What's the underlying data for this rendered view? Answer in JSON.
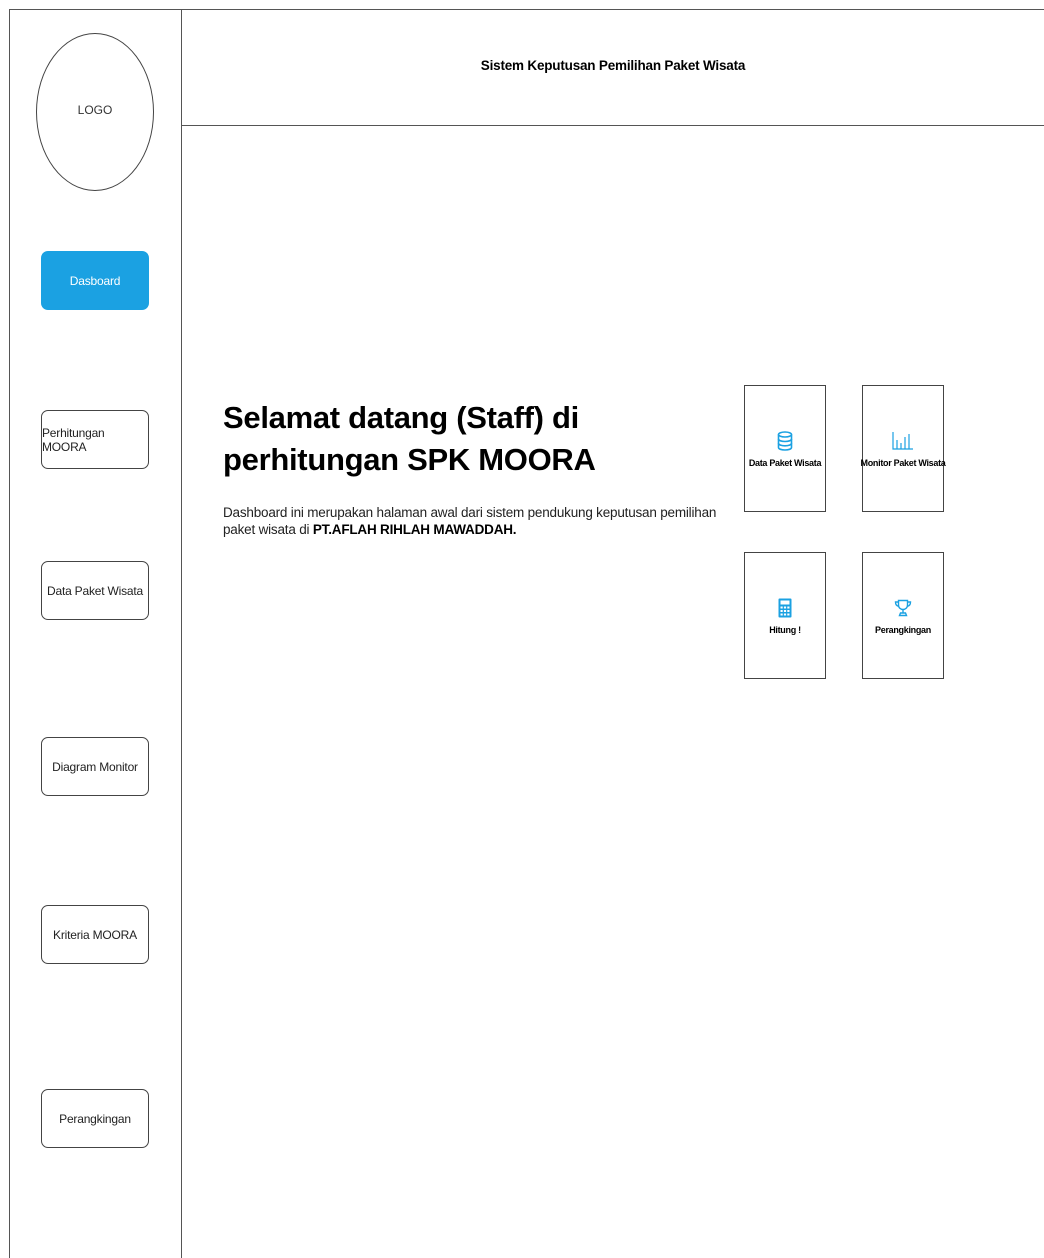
{
  "logo": {
    "text": "LOGO"
  },
  "header": {
    "title": "Sistem Keputusan Pemilihan Paket Wisata"
  },
  "sidebar": {
    "items": [
      {
        "label": "Dasboard",
        "active": true,
        "icon": ""
      },
      {
        "label": "Perhitungan MOORA",
        "active": false
      },
      {
        "label": "Data Paket Wisata",
        "active": false
      },
      {
        "label": "Diagram Monitor",
        "active": false
      },
      {
        "label": "Kriteria MOORA",
        "active": false
      },
      {
        "label": "Perangkingan",
        "active": false
      }
    ]
  },
  "main": {
    "welcome_title": "Selamat datang (Staff) di perhitungan SPK MOORA",
    "welcome_desc_prefix": "Dashboard ini merupakan halaman awal dari sistem pendukung keputusan pemilihan paket wisata di ",
    "welcome_desc_company": "PT.AFLAH RIHLAH MAWADDAH."
  },
  "cards": [
    {
      "label": "Data Paket Wisata",
      "icon": "database-icon"
    },
    {
      "label": "Monitor Paket Wisata",
      "icon": "bar-chart-icon"
    },
    {
      "label": "Hitung !",
      "icon": "calculator-icon"
    },
    {
      "label": "Perangkingan",
      "icon": "trophy-icon"
    }
  ],
  "colors": {
    "accent": "#1ba1e2",
    "border": "#444444",
    "icon_blue": "#1ba1e2"
  }
}
